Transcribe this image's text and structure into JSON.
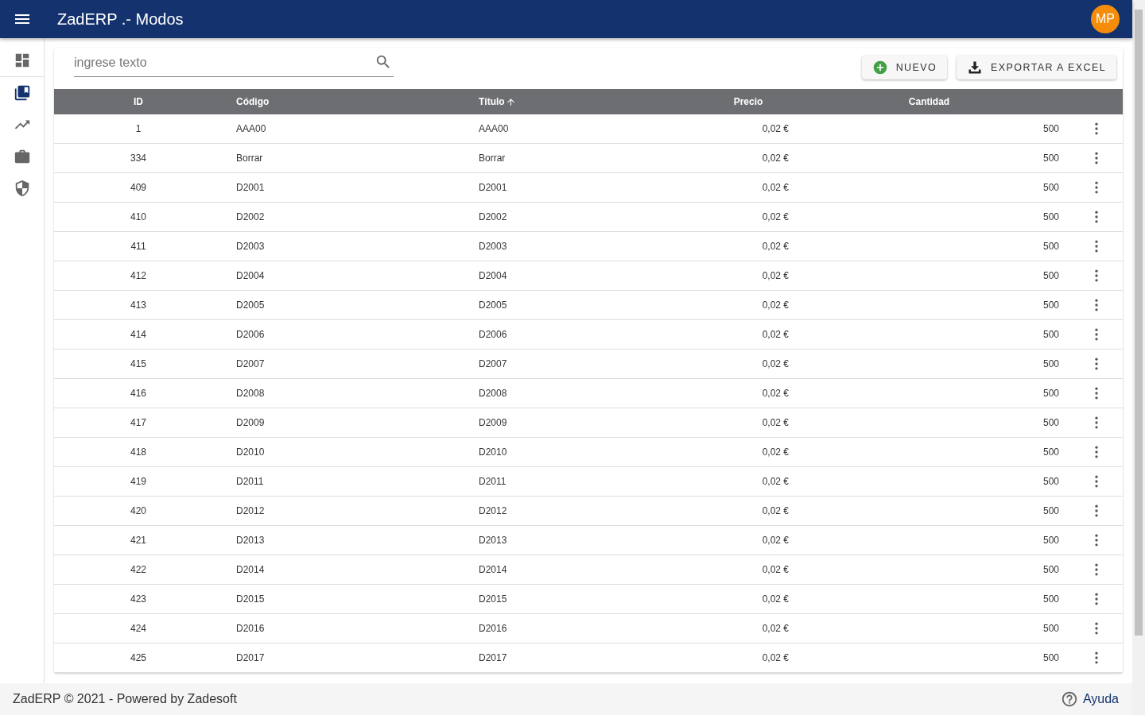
{
  "app_bar": {
    "title": "ZadERP .- Modos",
    "avatar": "MP"
  },
  "sidebar": {
    "items": [
      {
        "kind": "dashboard",
        "selected": false
      },
      {
        "kind": "library",
        "selected": true
      },
      {
        "kind": "trending",
        "selected": false
      },
      {
        "kind": "briefcase",
        "selected": false
      },
      {
        "kind": "shield",
        "selected": false
      }
    ]
  },
  "search": {
    "placeholder": "ingrese texto"
  },
  "buttons": [
    {
      "kind": "add",
      "label": "NUEVO"
    },
    {
      "kind": "download",
      "label": "EXPORTAR A EXCEL"
    }
  ],
  "table": {
    "columns": [
      {
        "label": "ID",
        "sorted": false
      },
      {
        "label": "Código",
        "sorted": false
      },
      {
        "label": "Título",
        "sorted": true
      },
      {
        "label": "Precio",
        "sorted": false
      },
      {
        "label": "Cantidad",
        "sorted": false
      }
    ],
    "rows": [
      [
        "1",
        "AAA00",
        "AAA00",
        "0,02 €",
        "500"
      ],
      [
        "334",
        "Borrar",
        "Borrar",
        "0,02 €",
        "500"
      ],
      [
        "409",
        "D2001",
        "D2001",
        "0,02 €",
        "500"
      ],
      [
        "410",
        "D2002",
        "D2002",
        "0,02 €",
        "500"
      ],
      [
        "411",
        "D2003",
        "D2003",
        "0,02 €",
        "500"
      ],
      [
        "412",
        "D2004",
        "D2004",
        "0,02 €",
        "500"
      ],
      [
        "413",
        "D2005",
        "D2005",
        "0,02 €",
        "500"
      ],
      [
        "414",
        "D2006",
        "D2006",
        "0,02 €",
        "500"
      ],
      [
        "415",
        "D2007",
        "D2007",
        "0,02 €",
        "500"
      ],
      [
        "416",
        "D2008",
        "D2008",
        "0,02 €",
        "500"
      ],
      [
        "417",
        "D2009",
        "D2009",
        "0,02 €",
        "500"
      ],
      [
        "418",
        "D2010",
        "D2010",
        "0,02 €",
        "500"
      ],
      [
        "419",
        "D2011",
        "D2011",
        "0,02 €",
        "500"
      ],
      [
        "420",
        "D2012",
        "D2012",
        "0,02 €",
        "500"
      ],
      [
        "421",
        "D2013",
        "D2013",
        "0,02 €",
        "500"
      ],
      [
        "422",
        "D2014",
        "D2014",
        "0,02 €",
        "500"
      ],
      [
        "423",
        "D2015",
        "D2015",
        "0,02 €",
        "500"
      ],
      [
        "424",
        "D2016",
        "D2016",
        "0,02 €",
        "500"
      ],
      [
        "425",
        "D2017",
        "D2017",
        "0,02 €",
        "500"
      ]
    ]
  },
  "footer": {
    "text": "ZadERP © 2021 - Powered by Zadesoft",
    "help": "Ayuda"
  }
}
